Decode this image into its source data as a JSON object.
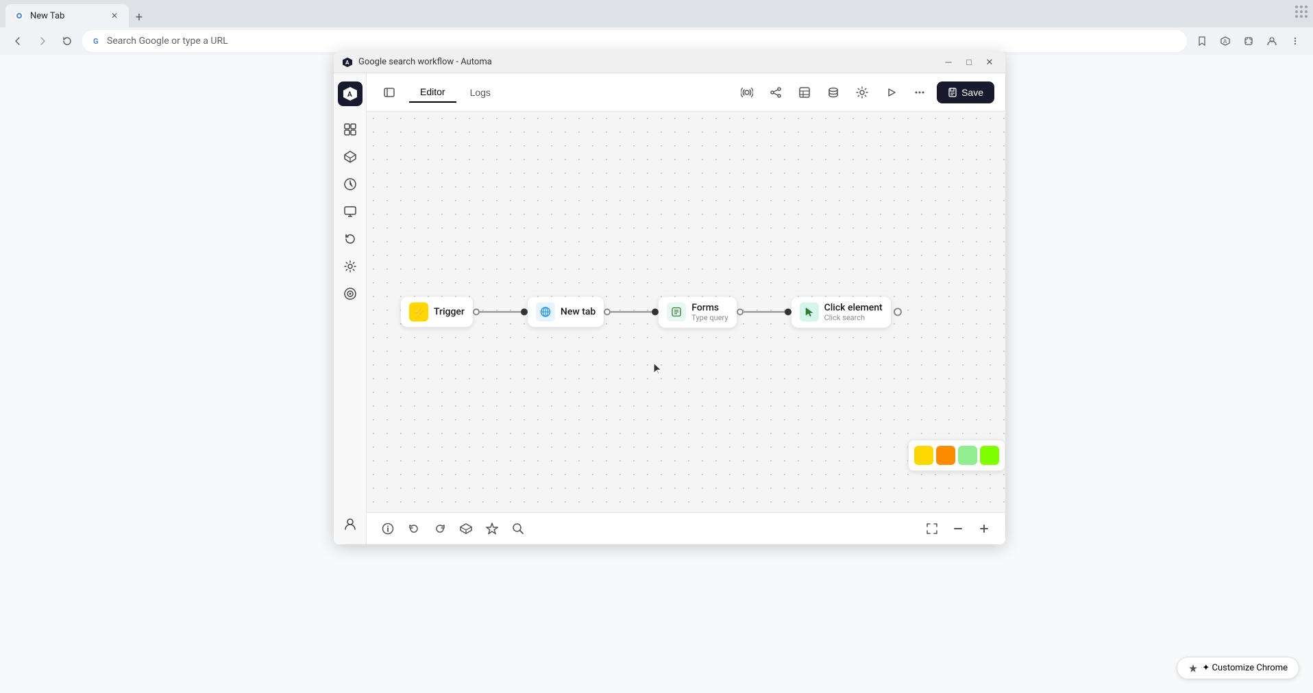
{
  "browser": {
    "tab_title": "New Tab",
    "tab_favicon": "🌐",
    "address_bar": {
      "url": "Search Google or type a URL",
      "favicon": "G"
    }
  },
  "popup": {
    "title": "Google search workflow - Automa",
    "window_buttons": {
      "minimize": "─",
      "maximize": "□",
      "close": "✕"
    }
  },
  "header": {
    "editor_tab": "Editor",
    "logs_tab": "Logs",
    "save_label": "Save"
  },
  "sidebar": {
    "items": [
      {
        "icon": "⊞",
        "name": "nodes-icon"
      },
      {
        "icon": "◈",
        "name": "blocks-icon"
      },
      {
        "icon": "◷",
        "name": "history-icon"
      },
      {
        "icon": "▭",
        "name": "monitor-icon"
      },
      {
        "icon": "↺",
        "name": "redo-icon"
      },
      {
        "icon": "⚙",
        "name": "settings-icon"
      },
      {
        "icon": "◎",
        "name": "target-icon"
      }
    ],
    "bottom": [
      {
        "icon": "👤",
        "name": "user-icon"
      }
    ]
  },
  "workflow": {
    "nodes": [
      {
        "id": "trigger",
        "icon": "⚡",
        "icon_class": "yellow",
        "label": "Trigger",
        "sublabel": ""
      },
      {
        "id": "new-tab",
        "icon": "🌐",
        "icon_class": "blue",
        "label": "New tab",
        "sublabel": ""
      },
      {
        "id": "forms",
        "icon": "⊞",
        "icon_class": "green",
        "label": "Forms",
        "sublabel": "Type query"
      },
      {
        "id": "click-element",
        "icon": "↗",
        "icon_class": "mint",
        "label": "Click element",
        "sublabel": "Click search"
      }
    ]
  },
  "toolbar": {
    "undo": "↩",
    "redo": "↪",
    "cube": "⬡",
    "star": "✦",
    "search": "⌕",
    "fullscreen": "⛶",
    "zoom_out": "−",
    "zoom_in": "+"
  },
  "color_palette": {
    "colors": [
      "#ffd700",
      "#ff8c00",
      "#90ee90",
      "#7fff00"
    ]
  },
  "customize_chrome": "✦ Customize Chrome"
}
